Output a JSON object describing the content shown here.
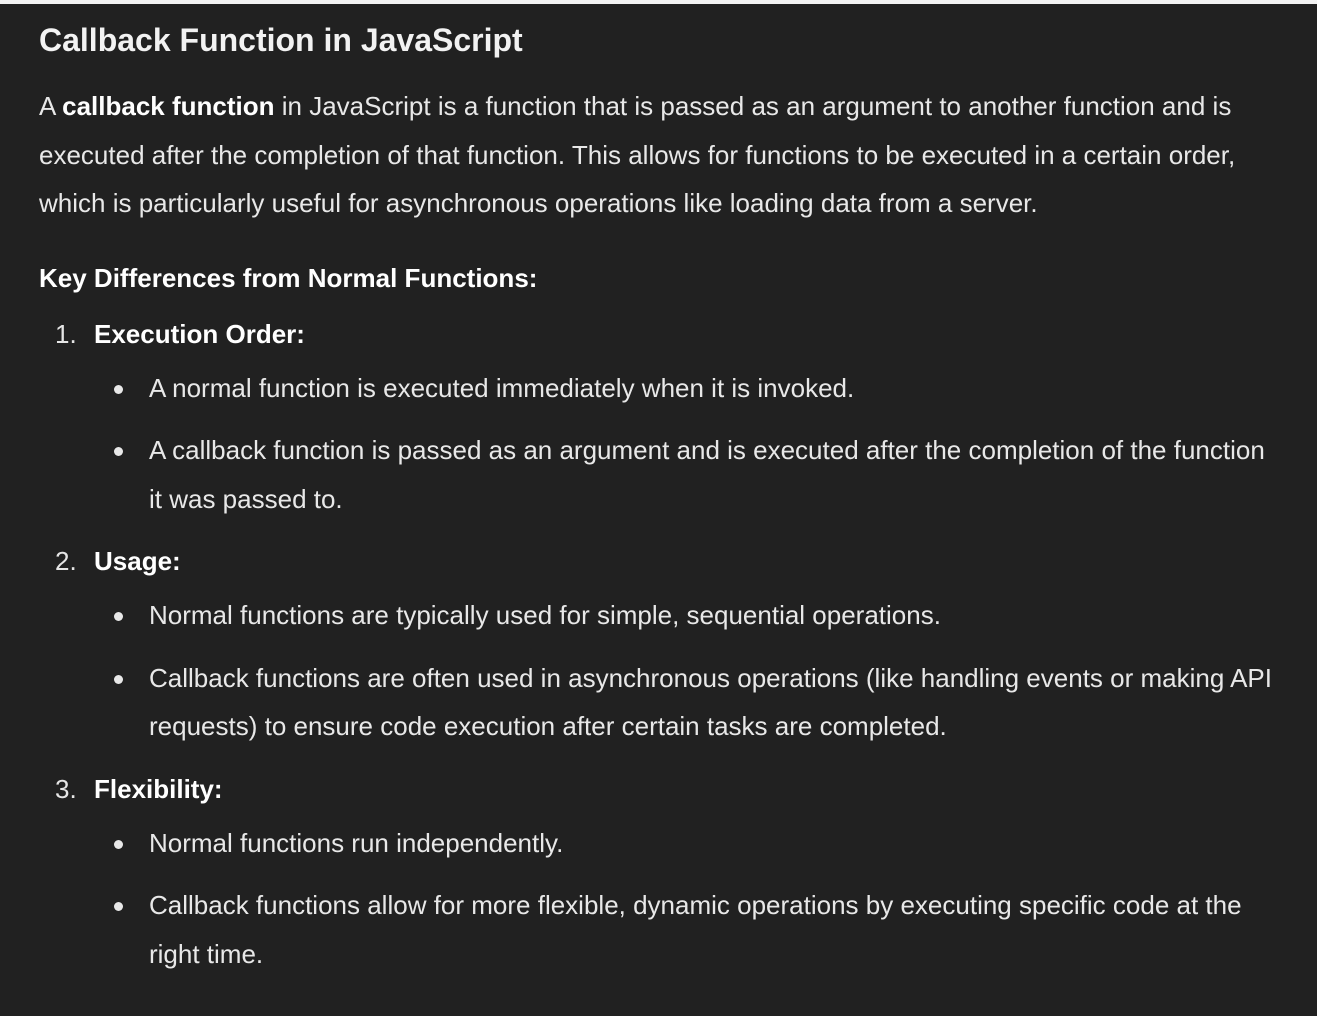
{
  "title": "Callback Function in JavaScript",
  "intro": {
    "prefix": "A ",
    "bold": "callback function",
    "suffix": " in JavaScript is a function that is passed as an argument to another function and is executed after the completion of that function. This allows for functions to be executed in a certain order, which is particularly useful for asynchronous operations like loading data from a server."
  },
  "section_heading": "Key Differences from Normal Functions:",
  "sections": [
    {
      "number": "1.",
      "title": "Execution Order:",
      "points": [
        "A normal function is executed immediately when it is invoked.",
        "A callback function is passed as an argument and is executed after the completion of the function it was passed to."
      ]
    },
    {
      "number": "2.",
      "title": "Usage:",
      "points": [
        "Normal functions are typically used for simple, sequential operations.",
        "Callback functions are often used in asynchronous operations (like handling events or making API requests) to ensure code execution after certain tasks are completed."
      ]
    },
    {
      "number": "3.",
      "title": "Flexibility:",
      "points": [
        "Normal functions run independently.",
        "Callback functions allow for more flexible, dynamic operations by executing specific code at the right time."
      ]
    }
  ]
}
